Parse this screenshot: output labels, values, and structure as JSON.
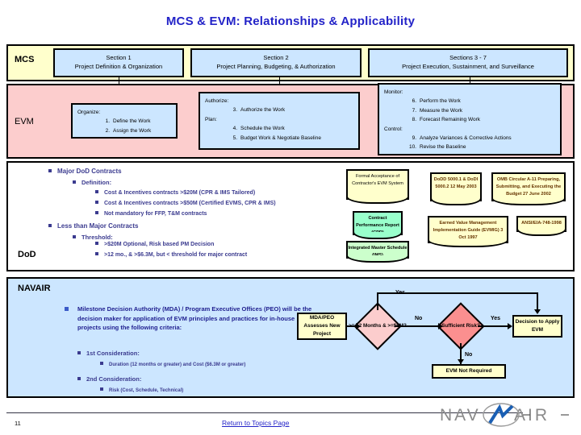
{
  "title": "MCS & EVM: Relationships & Applicability",
  "mcs": {
    "label": "MCS",
    "boxes": [
      {
        "line1": "Section 1",
        "line2": "Project Definition & Organization"
      },
      {
        "line1": "Section 2",
        "line2": "Project Planning, Budgeting, & Authorization"
      },
      {
        "line1": "Sections 3 - 7",
        "line2": "Project Execution, Sustainment, and Surveillance"
      }
    ]
  },
  "evm": {
    "label": "EVM",
    "box1": {
      "head": "Organize:",
      "items": [
        {
          "n": "1.",
          "t": "Define the Work"
        },
        {
          "n": "2.",
          "t": "Assign the Work"
        }
      ]
    },
    "box2": {
      "head1": "Authorize:",
      "items1": [
        {
          "n": "3.",
          "t": "Authorize the Work"
        }
      ],
      "head2": "Plan:",
      "items2": [
        {
          "n": "4.",
          "t": "Schedule the Work"
        },
        {
          "n": "5.",
          "t": "Budget Work & Negotiate Baseline"
        }
      ]
    },
    "box3": {
      "head1": "Monitor:",
      "items1": [
        {
          "n": "6.",
          "t": "Perform the Work"
        },
        {
          "n": "7.",
          "t": "Measure the Work"
        },
        {
          "n": "8.",
          "t": "Forecast Remaining Work"
        }
      ],
      "head2": "Control:",
      "items2": [
        {
          "n": "9.",
          "t": "Analyze Variances & Corrective Actions"
        },
        {
          "n": "10.",
          "t": "Revise the Baseline"
        }
      ]
    }
  },
  "dod": {
    "label": "DoD",
    "bullets": [
      "Major DoD Contracts",
      "Definition:",
      "Cost & Incentives contracts >$20M (CPR & IMS Tailored)",
      "Cost & Incentives contracts >$50M (Certified EVMS, CPR & IMS)",
      "Not mandatory for FFP, T&M contracts",
      "Less than Major Contracts",
      "Threshold:",
      ">$20M Optional, Risk based PM Decision",
      ">12 mo., & >$6.3M, but < threshold for major contract"
    ],
    "docs": {
      "formal_acceptance": "Formal Acceptance of Contractor's EVM System",
      "cpr": "Contract Performance Report (CPR)",
      "ims": "Integrated Master Schedule (IMS)",
      "dodd": "DoDD 5000.1 & DoDI 5000.2 12 May 2003",
      "omb": "OMB Circular A-11 Preparing, Submitting, and Executing the Budget 27 June 2002",
      "evmig": "Earned Value Management Implementation Guide (EVMIG) 3 Oct 1997",
      "ansi": "ANSI/EIA-748-1998"
    }
  },
  "navair": {
    "label": "NAVAIR",
    "main_bullet": "Milestone Decision Authority (MDA) / Program Executive Offices (PEO) will be the decision maker for application of EVM principles and practices for in-house projects using the following criteria:",
    "consideration1": "1st Consideration:",
    "consideration1_sub": "Duration (12 months or greater) and Cost ($6.3M or greater)",
    "consideration2": "2nd Consideration:",
    "consideration2_sub": "Risk (Cost, Schedule, Technical)",
    "flow": {
      "start": "MDA/PEO Assesses New Project",
      "decision1": ">= 12 Months & >=$6M?",
      "decision2": "Sufficient Risk?",
      "result_yes": "Decision to Apply EVM",
      "result_no": "EVM Not Required",
      "label_yes_top": "Yes",
      "label_no_1": "No",
      "label_yes_2": "Yes",
      "label_no_2": "No"
    }
  },
  "footer": {
    "page": "11",
    "return_link": "Return to Topics Page",
    "logo_left": "NAV",
    "logo_right": "AIR"
  },
  "colors": {
    "title": "#2323c8",
    "mcs_band": "#ffffcc",
    "evm_band": "#fccdcd",
    "box_blue": "#cce6ff",
    "bullet": "#3b3b8f",
    "diamond1": "#fccdcd",
    "diamond2": "#fb8f8f",
    "doc_cream": "#ffffcc",
    "doc_green": "#99ffcc",
    "doc_lgreen": "#ccffcc"
  }
}
